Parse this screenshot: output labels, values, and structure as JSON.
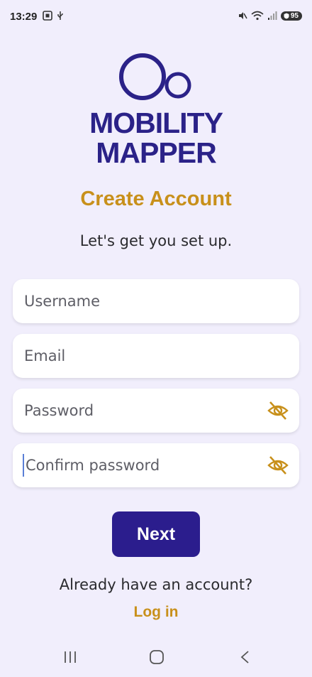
{
  "status_bar": {
    "time": "13:29",
    "battery": "95",
    "icons": [
      "screenshot-icon",
      "usb-icon",
      "mute-icon",
      "wifi-icon",
      "signal-icon",
      "battery-icon"
    ]
  },
  "logo": {
    "line1": "MOBILITY",
    "line2": "MAPPER"
  },
  "header": {
    "title": "Create Account",
    "subtitle": "Let's get you set up."
  },
  "form": {
    "username": {
      "placeholder": "Username",
      "value": ""
    },
    "email": {
      "placeholder": "Email",
      "value": ""
    },
    "password": {
      "placeholder": "Password",
      "value": ""
    },
    "confirm_password": {
      "placeholder": "Confirm password",
      "value": ""
    }
  },
  "actions": {
    "next_label": "Next",
    "already_text": "Already have an account?",
    "login_label": "Log in"
  },
  "colors": {
    "background": "#f1eefc",
    "primary": "#2b1d8d",
    "accent": "#c8901b"
  },
  "nav_bar": {
    "icons": [
      "recents-icon",
      "home-icon",
      "back-icon"
    ]
  }
}
